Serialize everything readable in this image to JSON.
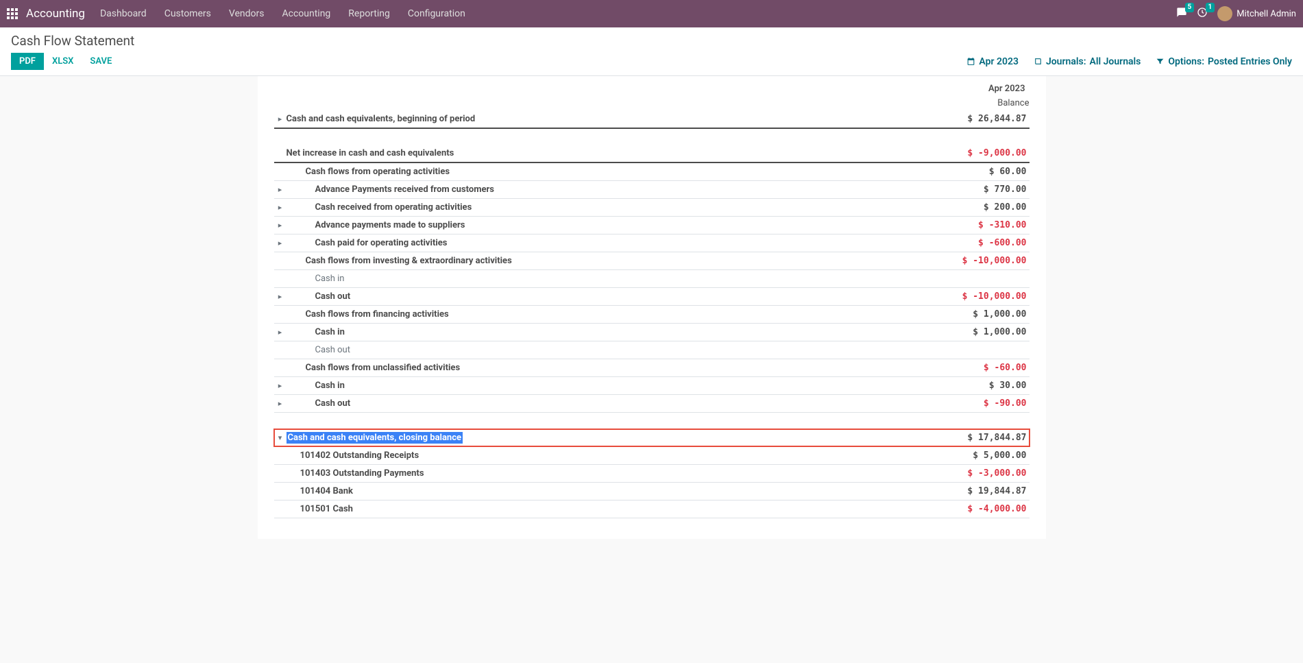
{
  "navbar": {
    "brand": "Accounting",
    "menu": [
      "Dashboard",
      "Customers",
      "Vendors",
      "Accounting",
      "Reporting",
      "Configuration"
    ],
    "messages_badge": "5",
    "activities_badge": "1",
    "user_name": "Mitchell Admin"
  },
  "page": {
    "title": "Cash Flow Statement",
    "btn_pdf": "PDF",
    "btn_xlsx": "XLSX",
    "btn_save": "SAVE",
    "filter_period": "Apr 2023",
    "filter_journals_label": "Journals:",
    "filter_journals_value": " All Journals",
    "filter_options_label": "Options:",
    "filter_options_value": "Posted Entries Only"
  },
  "report": {
    "period_header": "Apr 2023",
    "balance_header": "Balance",
    "rows": [
      {
        "caret": "right",
        "lvl": "0",
        "bold": true,
        "label": "Cash and cash equivalents, beginning of period",
        "amount": "$ 26,844.87",
        "neg": false,
        "thick": true
      },
      {
        "gap": true
      },
      {
        "caret": "",
        "lvl": "0",
        "bold": true,
        "label": "Net increase in cash and cash equivalents",
        "amount": "$ -9,000.00",
        "neg": true,
        "thick": true
      },
      {
        "caret": "",
        "lvl": "1",
        "bold": true,
        "label": "Cash flows from operating activities",
        "amount": "$ 60.00",
        "neg": false
      },
      {
        "caret": "right",
        "lvl": "2",
        "bold": true,
        "label": "Advance Payments received from customers",
        "amount": "$ 770.00",
        "neg": false
      },
      {
        "caret": "right",
        "lvl": "2",
        "bold": true,
        "label": "Cash received from operating activities",
        "amount": "$ 200.00",
        "neg": false
      },
      {
        "caret": "right",
        "lvl": "2",
        "bold": true,
        "label": "Advance payments made to suppliers",
        "amount": "$ -310.00",
        "neg": true
      },
      {
        "caret": "right",
        "lvl": "2",
        "bold": true,
        "label": "Cash paid for operating activities",
        "amount": "$ -600.00",
        "neg": true
      },
      {
        "caret": "",
        "lvl": "1",
        "bold": true,
        "label": "Cash flows from investing & extraordinary activities",
        "amount": "$ -10,000.00",
        "neg": true
      },
      {
        "caret": "",
        "lvl": "2",
        "light": true,
        "label": "Cash in",
        "amount": "",
        "neg": false
      },
      {
        "caret": "right",
        "lvl": "2",
        "bold": true,
        "label": "Cash out",
        "amount": "$ -10,000.00",
        "neg": true
      },
      {
        "caret": "",
        "lvl": "1",
        "bold": true,
        "label": "Cash flows from financing activities",
        "amount": "$ 1,000.00",
        "neg": false
      },
      {
        "caret": "right",
        "lvl": "2",
        "bold": true,
        "label": "Cash in",
        "amount": "$ 1,000.00",
        "neg": false
      },
      {
        "caret": "",
        "lvl": "2",
        "light": true,
        "label": "Cash out",
        "amount": "",
        "neg": false
      },
      {
        "caret": "",
        "lvl": "1",
        "bold": true,
        "label": "Cash flows from unclassified activities",
        "amount": "$ -60.00",
        "neg": true
      },
      {
        "caret": "right",
        "lvl": "2",
        "bold": true,
        "label": "Cash in",
        "amount": "$ 30.00",
        "neg": false
      },
      {
        "caret": "right",
        "lvl": "2",
        "bold": true,
        "label": "Cash out",
        "amount": "$ -90.00",
        "neg": true
      },
      {
        "gap": true
      },
      {
        "caret": "down",
        "lvl": "0",
        "bold": true,
        "label": "Cash and cash equivalents, closing balance",
        "amount": "$ 17,844.87",
        "neg": false,
        "highlight": true
      },
      {
        "caret": "",
        "lvl": "1b",
        "bold": true,
        "label": "101402 Outstanding Receipts",
        "amount": "$ 5,000.00",
        "neg": false
      },
      {
        "caret": "",
        "lvl": "1b",
        "bold": true,
        "label": "101403 Outstanding Payments",
        "amount": "$ -3,000.00",
        "neg": true
      },
      {
        "caret": "",
        "lvl": "1b",
        "bold": true,
        "label": "101404 Bank",
        "amount": "$ 19,844.87",
        "neg": false
      },
      {
        "caret": "",
        "lvl": "1b",
        "bold": true,
        "label": "101501 Cash",
        "amount": "$ -4,000.00",
        "neg": true
      }
    ]
  }
}
